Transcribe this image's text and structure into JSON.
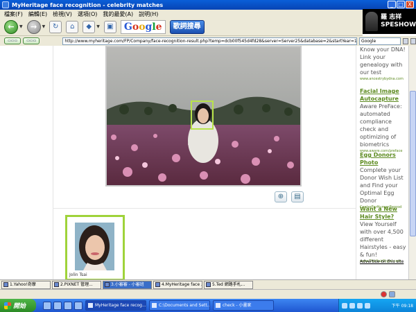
{
  "window": {
    "title": "MyHeritage face recognition - celebrity matches",
    "controls": [
      "_",
      "□",
      "X"
    ]
  },
  "promo": {
    "line1": "羅 志祥",
    "line2": "SPESHOW"
  },
  "menu": [
    "檔案(F)",
    "編輯(E)",
    "檢視(V)",
    "選項(O)",
    "我的最愛(A)",
    "說明(H)"
  ],
  "toolbar": {
    "back_label": "←",
    "forward_label": "→",
    "google_text": [
      "G",
      "o",
      "o",
      "g",
      "l",
      "e"
    ],
    "search_button": "歌詞搜尋"
  },
  "addressbar": {
    "url": "http://www.myheritage.com/FP/Company/face-recognition-result.php?temp=dcb00f545d4fd28&server=Server25&database=2&startYear=1800&endYear=",
    "search_placeholder": "Google"
  },
  "ads": [
    {
      "title": "",
      "body": "Know your DNA! Link your genealogy with our test",
      "url": "www.ancestrybydna.com"
    },
    {
      "title": "Facial Image Autocapture",
      "body": "Aware PreFace: automated compliance check and optimizing of biometrics",
      "url": "www.aware.com/preface"
    },
    {
      "title": "Egg Donors Photo",
      "body": "Complete your Donor Wish List and Find your Optimal Egg Donor",
      "url": "CenterForHumanReprod"
    },
    {
      "title": "Want a New Hair Style?",
      "body": "View Yourself with over 4,500 different Hairstyles - easy & fun!",
      "url": "www.TheHairStyler.com"
    }
  ],
  "advertise_link": "Advertise on this site",
  "match": {
    "name": "Jolin Tsai"
  },
  "browser_tabs": [
    {
      "label": "1.Yahoo!奇摩",
      "active": false
    },
    {
      "label": "2.PIXNET 管理...",
      "active": false
    },
    {
      "label": "3.小審審 - 小審班",
      "active": true
    },
    {
      "label": "4.MyHeritage face ...",
      "active": false
    },
    {
      "label": "5.Ted 網路手札...",
      "active": false
    }
  ],
  "taskbar": {
    "start_label": "開始",
    "tasks": [
      {
        "label": "MyHeritage face recog...",
        "active": true
      },
      {
        "label": "C:\\Documents and Sett...",
        "active": false
      },
      {
        "label": "check - 小畫家",
        "active": false
      }
    ],
    "clock": "下午 09:18"
  },
  "colors": {
    "titlebar": "#0a5fd8",
    "ad_title": "#5c8a1f",
    "match_border": "#9fd33a",
    "face_box": "#b9e34a"
  }
}
